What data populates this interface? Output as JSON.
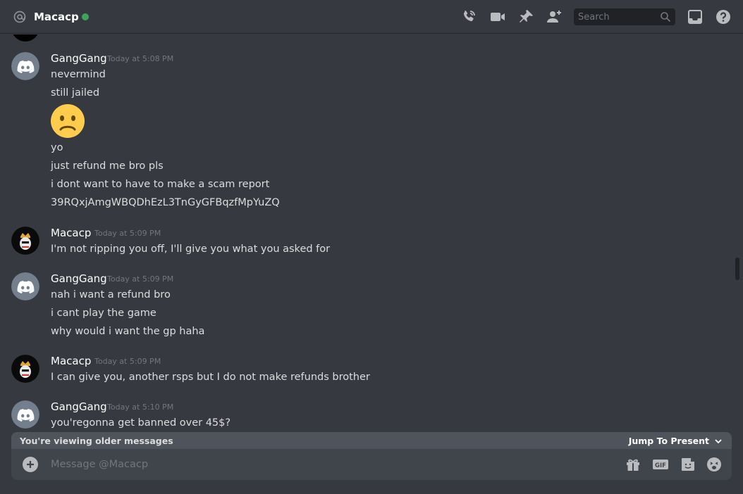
{
  "header": {
    "channel_name": "Macacp",
    "status_color": "#3ba55c",
    "search_placeholder": "Search",
    "icons": [
      "at-icon",
      "call-icon",
      "video-icon",
      "pin-icon",
      "add-friend-icon",
      "search-icon",
      "inbox-icon",
      "help-icon"
    ]
  },
  "messages": [
    {
      "author": "GangGang",
      "avatar": "discord-default-avatar",
      "timestamp": "Today at 5:08 PM",
      "lines": [
        "nevermind",
        "still jailed",
        "yo",
        "just refund me bro pls",
        "i dont want to have to make a scam report",
        "39RQxjAmgWBQDhEzL3TnGyGFBqzfMpYuZQ"
      ],
      "emoji": "frowning-face-emoji"
    },
    {
      "author": "Macacp",
      "avatar": "crowned-monkey-avatar",
      "timestamp": "Today at 5:09 PM",
      "lines": [
        "I'm not ripping you off, I'll give you what you asked for"
      ]
    },
    {
      "author": "GangGang",
      "avatar": "discord-default-avatar",
      "timestamp": "Today at 5:09 PM",
      "lines": [
        "nah i want a refund bro",
        "i cant play the game",
        "why would i want the gp haha"
      ]
    },
    {
      "author": "Macacp",
      "avatar": "crowned-monkey-avatar",
      "timestamp": "Today at 5:09 PM",
      "lines": [
        "I can give you, another rsps but I do not make refunds brother"
      ]
    },
    {
      "author": "GangGang",
      "avatar": "discord-default-avatar",
      "timestamp": "Today at 5:10 PM",
      "lines": [
        "you'regonna get banned over 45$?"
      ]
    }
  ],
  "older_bar": {
    "text": "You're viewing older messages",
    "jump_label": "Jump To Present"
  },
  "composer": {
    "placeholder": "Message @Macacp",
    "icons": [
      "add-attachment-icon",
      "gift-icon",
      "gif-icon",
      "sticker-icon",
      "emoji-icon"
    ]
  },
  "colors": {
    "background": "#36393f",
    "composer": "#40444b",
    "banner": "#4f545c",
    "blurple": "#5865f2"
  }
}
